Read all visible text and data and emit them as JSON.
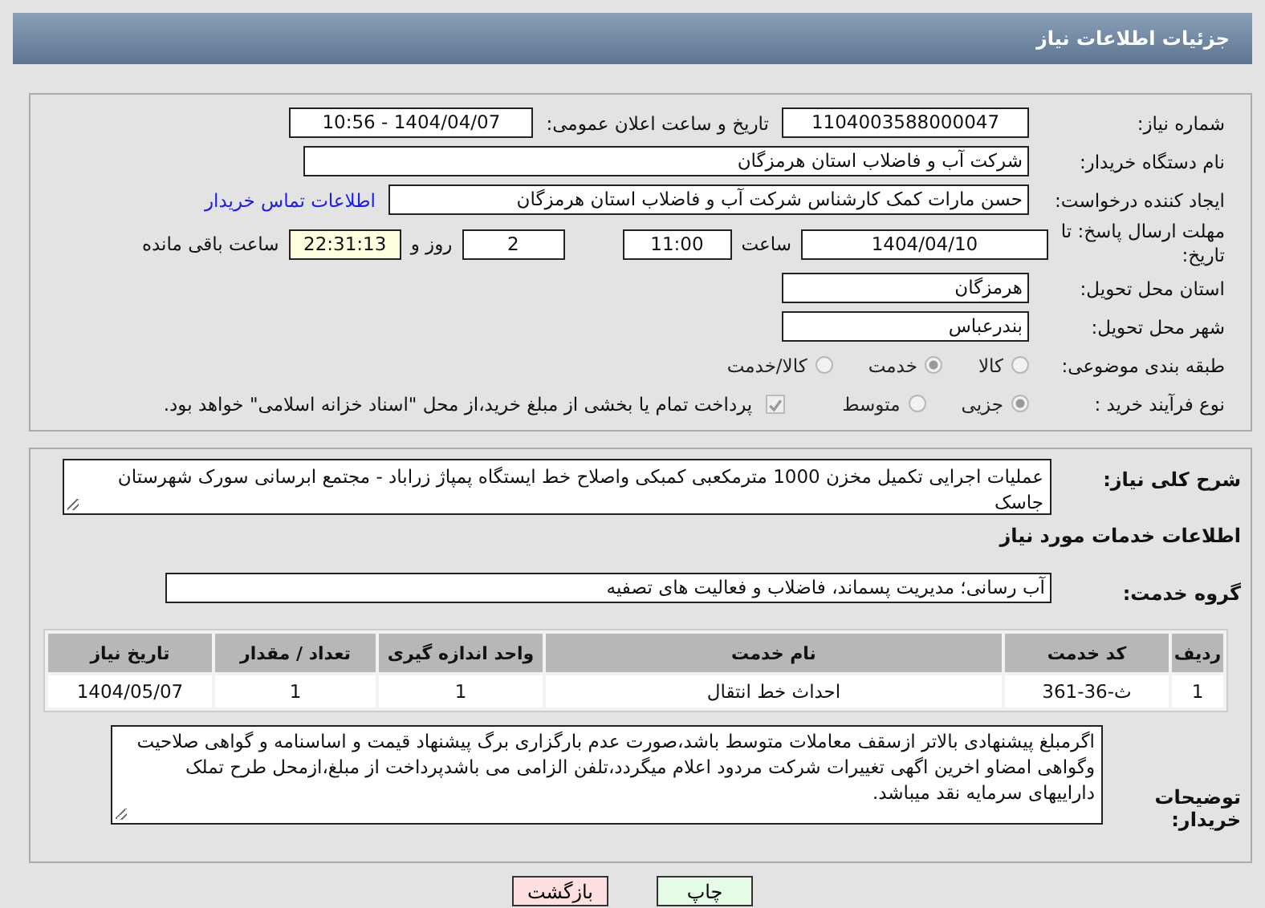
{
  "header": {
    "title": "جزئیات اطلاعات نیاز"
  },
  "need_number": {
    "label": "شماره نیاز:",
    "value": "1104003588000047"
  },
  "announce_date": {
    "label": "تاریخ و ساعت اعلان عمومی:",
    "value": "1404/04/07 - 10:56"
  },
  "buyer": {
    "label": "نام دستگاه خریدار:",
    "value": "شرکت آب و فاضلاب استان هرمزگان"
  },
  "requester": {
    "label": "ایجاد کننده درخواست:",
    "value": "حسن مارات کمک کارشناس شرکت آب و فاضلاب استان هرمزگان",
    "link": "اطلاعات تماس خریدار"
  },
  "deadline": {
    "label": "مهلت ارسال پاسخ: تا تاریخ:",
    "date": "1404/04/10",
    "time_label": "ساعت",
    "time": "11:00",
    "days": "2",
    "days_label": "روز و",
    "remaining": "22:31:13",
    "remaining_label": "ساعت باقی مانده"
  },
  "province": {
    "label": "استان محل تحویل:",
    "value": "هرمزگان"
  },
  "city": {
    "label": "شهر محل تحویل:",
    "value": "بندرعباس"
  },
  "category": {
    "label": "طبقه بندی موضوعی:",
    "options": [
      {
        "label": "کالا",
        "selected": false
      },
      {
        "label": "خدمت",
        "selected": true
      },
      {
        "label": "کالا/خدمت",
        "selected": false
      }
    ]
  },
  "process": {
    "label": "نوع فرآیند خرید :",
    "options": [
      {
        "label": "جزیی",
        "selected": true
      },
      {
        "label": "متوسط",
        "selected": false
      }
    ],
    "payment": {
      "label": "پرداخت تمام یا بخشی از مبلغ خرید،از محل \"اسناد خزانه اسلامی\" خواهد بود.",
      "checked": true
    }
  },
  "description": {
    "label": "شرح کلی نیاز:",
    "value": "عملیات اجرایی تکمیل مخزن 1000 مترمکعبی کمبکی واصلاح خط ایستگاه پمپاژ زراباد - مجتمع ابرسانی سورک شهرستان جاسک"
  },
  "services_title": "اطلاعات خدمات مورد نیاز",
  "service_group": {
    "label": "گروه خدمت:",
    "value": "آب رسانی؛ مدیریت پسماند، فاضلاب و فعالیت های تصفیه"
  },
  "table": {
    "columns": [
      "ردیف",
      "کد خدمت",
      "نام خدمت",
      "واحد اندازه گیری",
      "تعداد / مقدار",
      "تاریخ نیاز"
    ],
    "rows": [
      [
        "1",
        "ث-36-361",
        "احداث خط انتقال",
        "1",
        "1",
        "1404/05/07"
      ]
    ]
  },
  "buyer_notes": {
    "label": "توضیحات خریدار:",
    "value": "اگرمبلغ پیشنهادی بالاتر ازسقف معاملات متوسط باشد،صورت عدم بارگزاری برگ پیشنهاد قیمت و اساسنامه و گواهی صلاحیت وگواهی امضاو اخرین اگهی تغییرات شرکت مردود اعلام میگردد،تلفن الزامی می باشدپرداخت از مبلغ،ازمحل طرح تملک داراییهای سرمایه نقد میباشد."
  },
  "buttons": [
    {
      "label": "چاپ",
      "kind": "print"
    },
    {
      "label": "بازگشت",
      "kind": "back"
    }
  ]
}
